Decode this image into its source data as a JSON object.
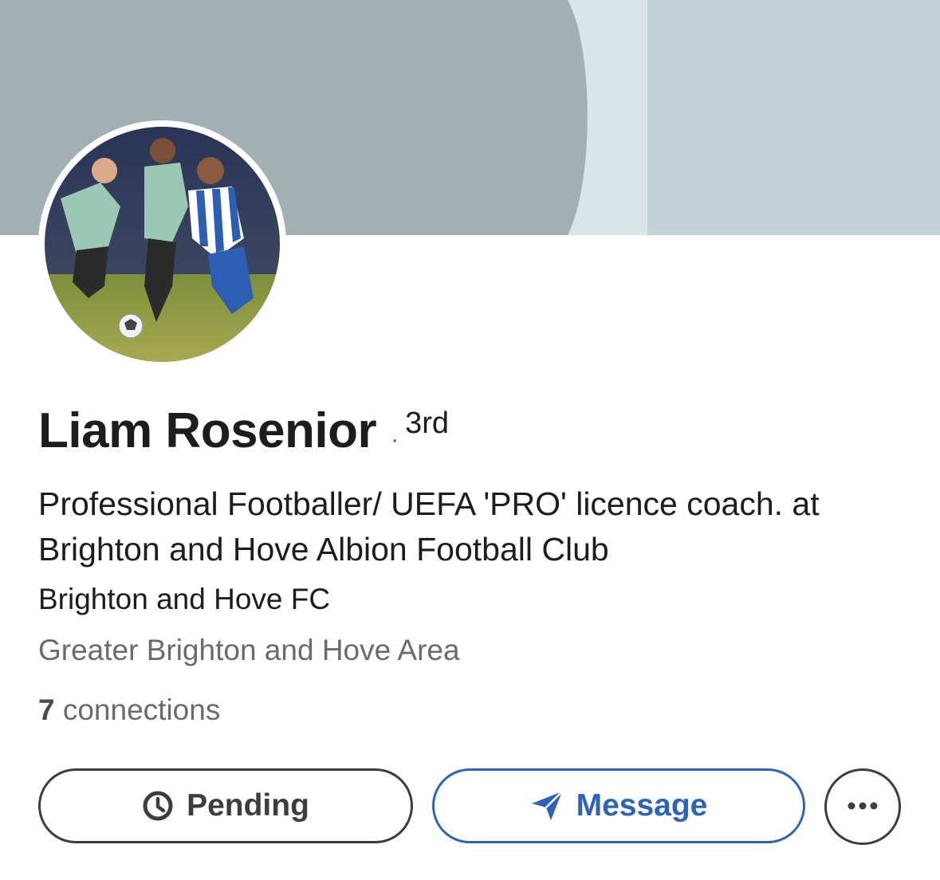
{
  "profile": {
    "name": "Liam Rosenior",
    "degree_separator": "·",
    "degree": "3rd",
    "headline": "Professional Footballer/ UEFA 'PRO' licence coach. at Brighton and Hove Albion Football Club",
    "company": "Brighton and Hove FC",
    "location": "Greater Brighton and Hove Area",
    "connections_count": "7",
    "connections_label": "connections"
  },
  "actions": {
    "pending_label": "Pending",
    "pending_icon": "clock-icon",
    "message_label": "Message",
    "message_icon": "send-icon",
    "more_icon": "more-icon"
  },
  "colors": {
    "primary_blue": "#2e64b8",
    "banner_gray": "#a3b0b3",
    "banner_light": "#dbe4e6",
    "banner_right": "#c1d1d5"
  }
}
